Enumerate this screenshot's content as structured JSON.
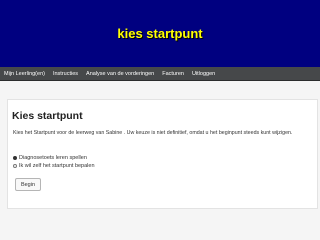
{
  "banner": {
    "title": "kies startpunt"
  },
  "nav": {
    "items": [
      {
        "label": "Mijn Leerling(en)"
      },
      {
        "label": "Instructies"
      },
      {
        "label": "Analyse van de vorderingen"
      },
      {
        "label": "Facturen"
      },
      {
        "label": "Uitloggen"
      }
    ]
  },
  "main": {
    "title": "Kies startpunt",
    "intro": "Kies het Startpunt voor de leerweg van Sabine . Uw keuze is niet definitief, omdat u het beginpunt steeds kunt wijzigen.",
    "options": [
      {
        "label": "Diagnosetoets leren spellen",
        "selected": true
      },
      {
        "label": "Ik wil zelf het startpunt bepalen",
        "selected": false
      }
    ],
    "start_button": "Begin"
  },
  "colors": {
    "banner_bg": "#000080",
    "banner_text": "#ffff00",
    "nav_bg": "#46484a"
  }
}
